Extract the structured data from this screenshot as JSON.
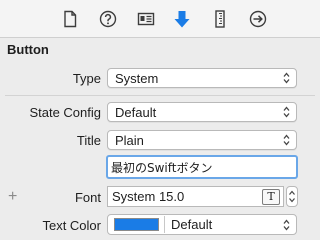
{
  "toolbar": {
    "tabs": [
      {
        "name": "file-inspector-icon"
      },
      {
        "name": "quick-help-icon"
      },
      {
        "name": "identity-inspector-icon"
      },
      {
        "name": "attributes-inspector-icon",
        "selected": true
      },
      {
        "name": "size-inspector-icon"
      },
      {
        "name": "connections-inspector-icon"
      }
    ],
    "accent_color": "#1a7ce6"
  },
  "section": {
    "title": "Button"
  },
  "type": {
    "label": "Type",
    "value": "System"
  },
  "state_config": {
    "label": "State Config",
    "value": "Default"
  },
  "title_field": {
    "label": "Title",
    "mode": "Plain",
    "text": "最初のSwiftボタン"
  },
  "font": {
    "label": "Font",
    "value": "System 15.0",
    "picker_glyph": "T",
    "add_symbol": "+"
  },
  "text_color": {
    "label": "Text Color",
    "value": "Default",
    "swatch_color": "#1a7ce6"
  }
}
